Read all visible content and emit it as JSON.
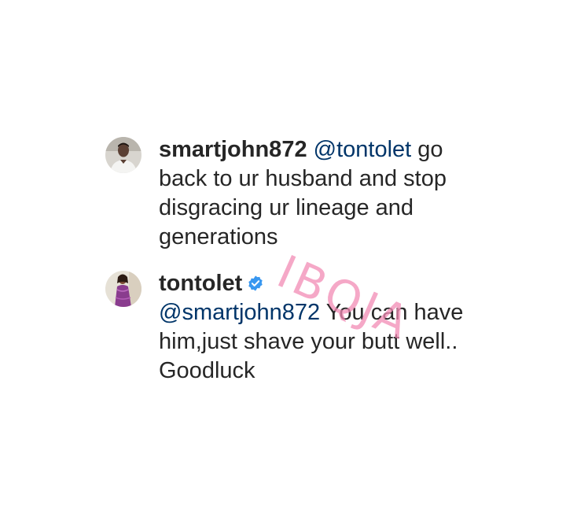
{
  "comments": [
    {
      "username": "smartjohn872",
      "avatar_icon": "user-avatar-man",
      "verified": false,
      "mention": "@tontolet",
      "text": "go back to ur husband and stop disgracing ur lineage and generations"
    },
    {
      "username": "tontolet",
      "avatar_icon": "user-avatar-woman-purple-dress",
      "verified": true,
      "mention": "@smartjohn872",
      "text": "You can have him,just shave your butt well.. Goodluck"
    }
  ],
  "watermark": {
    "text": "IBQJA",
    "color": "#f28bb4"
  },
  "colors": {
    "text": "#262626",
    "mention": "#003569",
    "verified": "#3897f0"
  }
}
